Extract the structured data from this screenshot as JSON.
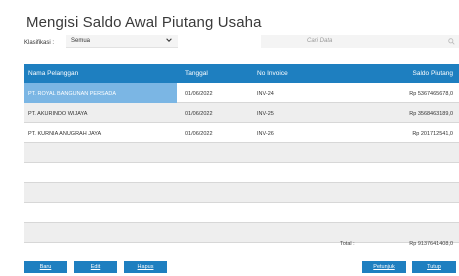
{
  "page": {
    "title": "Mengisi Saldo Awal Piutang Usaha"
  },
  "filter": {
    "label": "Klasifikasi :",
    "selected": "Semua"
  },
  "search": {
    "placeholder": "Cari Data"
  },
  "table": {
    "columns": [
      "Nama Pelanggan",
      "Tanggal",
      "No Invoice",
      "Saldo Piutang"
    ],
    "rows": [
      {
        "name": "PT. ROYAL BANGUNAN PERSADA",
        "date": "01/06/2022",
        "invoice": "INV-24",
        "saldo": "Rp 5367465678,0"
      },
      {
        "name": "PT. AKURINDO WIJAYA",
        "date": "01/06/2022",
        "invoice": "INV-25",
        "saldo": "Rp 3568463189,0"
      },
      {
        "name": "PT. KURNIA ANUGRAH JAYA",
        "date": "01/06/2022",
        "invoice": "INV-26",
        "saldo": "Rp 201712541,0"
      }
    ],
    "selected_row": 0
  },
  "total": {
    "label": "Total :",
    "value": "Rp 9137641408,0"
  },
  "buttons": {
    "baru": "Baru",
    "edit": "Edit",
    "hapus": "Hapus",
    "petunjuk": "Petunjuk",
    "tutup": "Tutup"
  },
  "colors": {
    "accent": "#1e7fc0",
    "selected": "#7bb6e4",
    "stripe": "#eeeeee"
  }
}
